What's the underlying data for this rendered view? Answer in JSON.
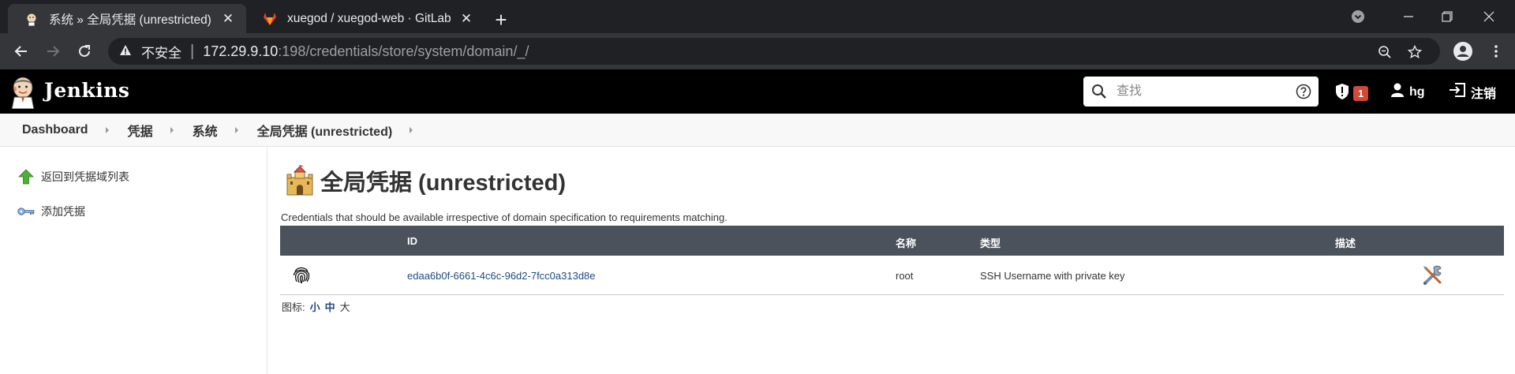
{
  "browser": {
    "tabs": [
      {
        "title": "系统 » 全局凭据 (unrestricted) | Jen",
        "active": true
      },
      {
        "title": "xuegod / xuegod-web · GitLab",
        "active": false
      }
    ],
    "omnibox": {
      "security_label": "不安全",
      "url_host": "172.29.9.10",
      "url_rest": ":198/credentials/store/system/domain/_/"
    }
  },
  "jenkins": {
    "brand": "Jenkins",
    "search_placeholder": "查找",
    "alert_count": "1",
    "user": "hg",
    "logout": "注销"
  },
  "breadcrumbs": [
    "Dashboard",
    "凭据",
    "系统",
    "全局凭据 (unrestricted)"
  ],
  "sidebar": {
    "items": [
      {
        "label": "返回到凭据域列表",
        "icon": "green-up-arrow-icon"
      },
      {
        "label": "添加凭据",
        "icon": "key-icon"
      }
    ]
  },
  "main": {
    "title": "全局凭据 (unrestricted)",
    "description": "Credentials that should be available irrespective of domain specification to requirements matching.",
    "table": {
      "headers": {
        "id": "ID",
        "name": "名称",
        "type": "类型",
        "desc": "描述"
      },
      "rows": [
        {
          "id": "edaa6b0f-6661-4c6c-96d2-7fcc0a313d8e",
          "name": "root",
          "type": "SSH Username with private key",
          "desc": ""
        }
      ]
    },
    "icon_size": {
      "label": "图标:",
      "small": "小",
      "medium": "中",
      "large": "大"
    }
  },
  "colors": {
    "header_bg": "#000000",
    "table_header_bg": "#4b525c",
    "link": "#204a87",
    "alert_badge": "#d24939"
  }
}
